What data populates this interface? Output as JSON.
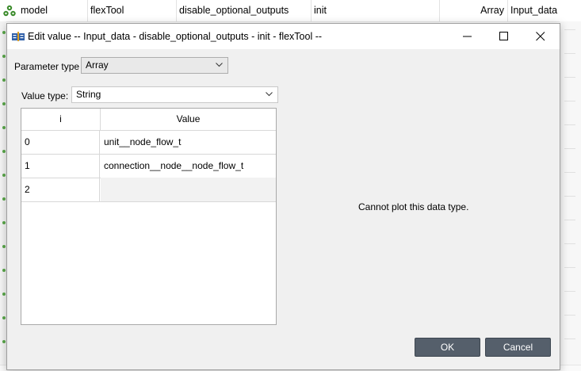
{
  "background_row": {
    "cells": [
      "model",
      "flexTool",
      "disable_optional_outputs",
      "init",
      "Array",
      "Input_data"
    ]
  },
  "dialog": {
    "title": "Edit value   -- Input_data - disable_optional_outputs - init - flexTool --",
    "parameter_type_label": "Parameter type",
    "parameter_type_value": "Array",
    "value_type_label": "Value type:",
    "value_type_value": "String",
    "table": {
      "headers": [
        "i",
        "Value"
      ],
      "rows": [
        {
          "index": "0",
          "value": "unit__node_flow_t"
        },
        {
          "index": "1",
          "value": "connection__node__node_flow_t"
        },
        {
          "index": "2",
          "value": ""
        }
      ]
    },
    "plot_message": "Cannot plot this data type.",
    "ok_label": "OK",
    "cancel_label": "Cancel"
  },
  "icons": {
    "app": "spine-nodes-icon",
    "dialog": "edit-value-icon",
    "minimize": "minimize-icon",
    "maximize": "maximize-icon",
    "close": "close-icon",
    "dropdown": "chevron-down-icon"
  },
  "colors": {
    "button_bg": "#555f6b",
    "dialog_bg": "#f0f0f0",
    "icon_green": "#3a8a2a",
    "icon_blue": "#2f5fa8"
  }
}
